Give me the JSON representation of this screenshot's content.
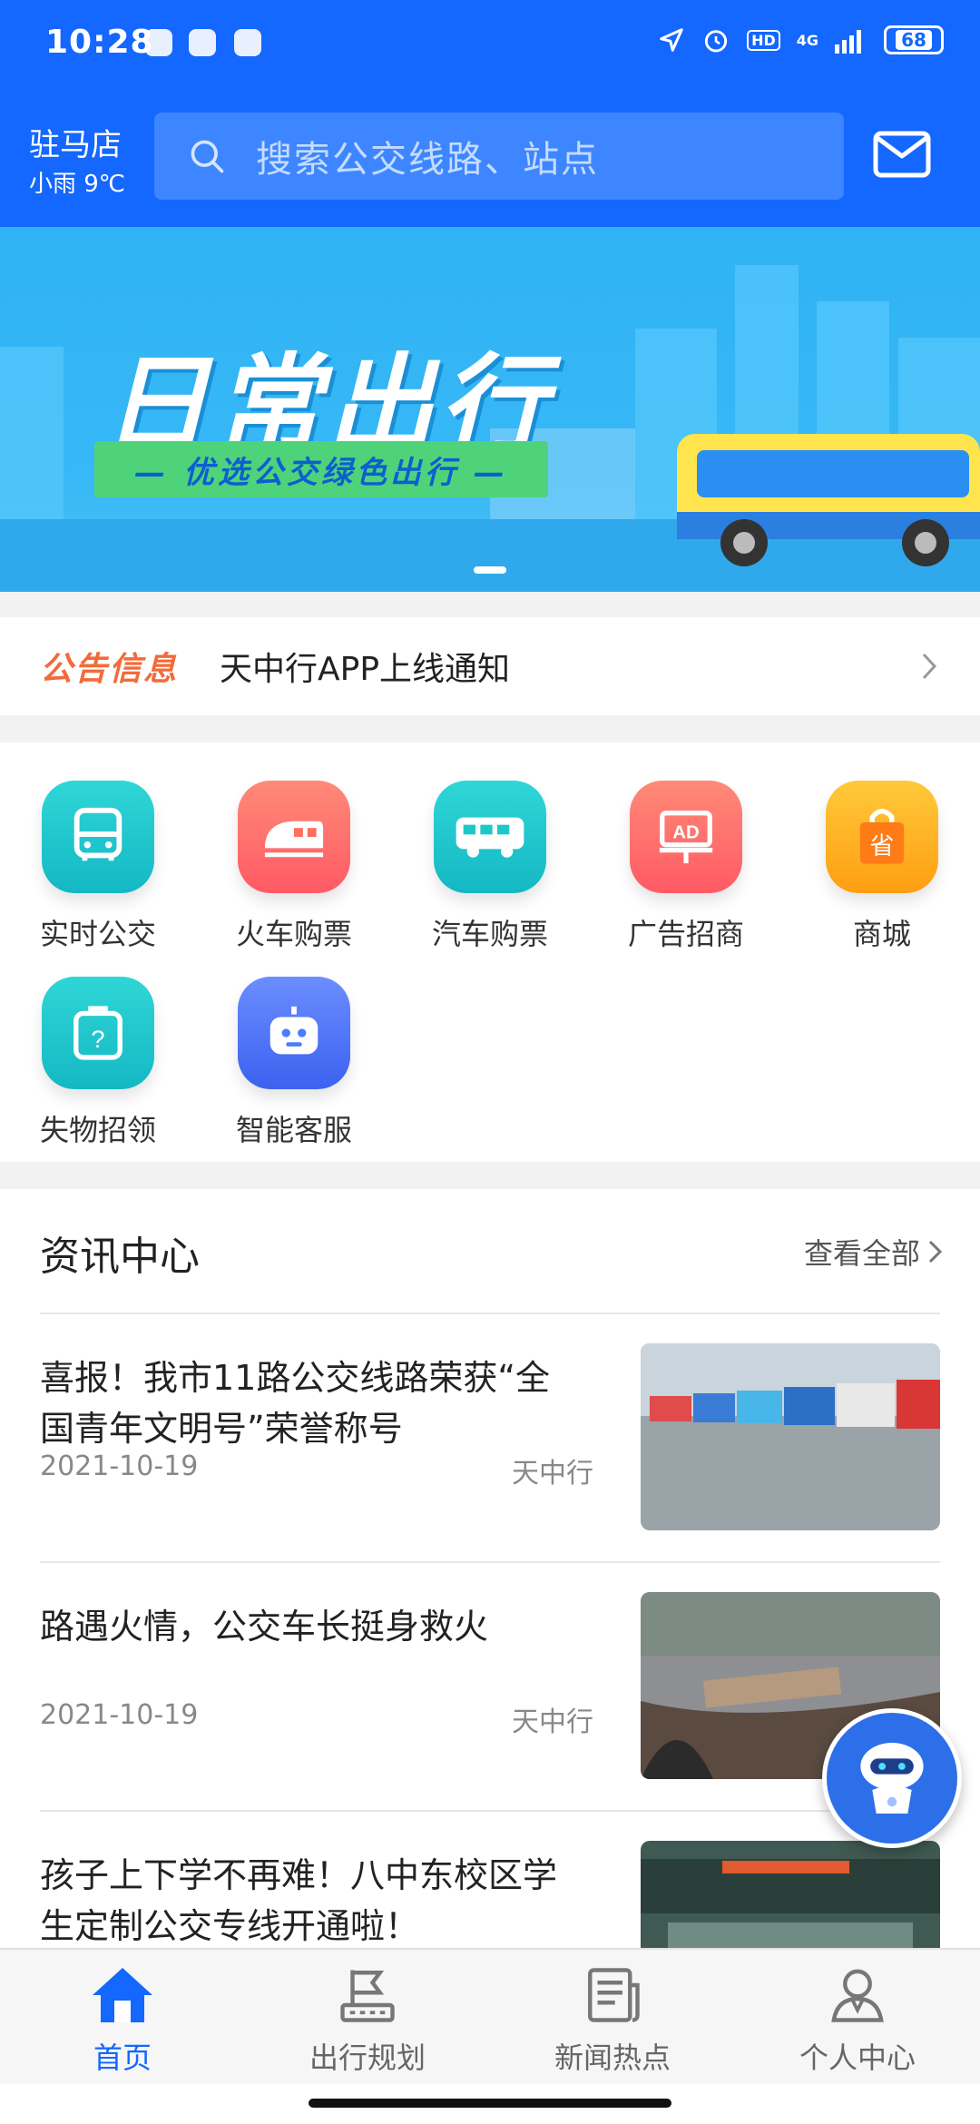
{
  "status_bar": {
    "time": "10:28",
    "network": "4G",
    "hd": "HD",
    "battery": "68"
  },
  "header": {
    "city": "驻马店",
    "weather": "小雨 9℃",
    "search_placeholder": "搜索公交线路、站点"
  },
  "banner": {
    "title": "日常出行",
    "subtitle": "— 优选公交绿色出行 —"
  },
  "notice": {
    "tag": "公告信息",
    "text": "天中行APP上线通知"
  },
  "services": [
    {
      "label": "实时公交",
      "icon": "bus-front-icon",
      "color": "#1ec8c8"
    },
    {
      "label": "火车购票",
      "icon": "train-icon",
      "color": "#ff6f61"
    },
    {
      "label": "汽车购票",
      "icon": "coach-bus-icon",
      "color": "#1ec8c8"
    },
    {
      "label": "广告招商",
      "icon": "ad-board-icon",
      "color": "#ff6f61"
    },
    {
      "label": "商城",
      "icon": "shopping-bag-icon",
      "color": "#ffb21c"
    },
    {
      "label": "失物招领",
      "icon": "luggage-question-icon",
      "color": "#1ec8c8"
    },
    {
      "label": "智能客服",
      "icon": "robot-icon",
      "color": "#4d7bff"
    }
  ],
  "news": {
    "title": "资讯中心",
    "more": "查看全部",
    "articles": [
      {
        "title": "喜报！我市11路公交线路荣获“全国青年文明号”荣誉称号",
        "date": "2021-10-19",
        "source": "天中行"
      },
      {
        "title": "路遇火情，公交车长挺身救火",
        "date": "2021-10-19",
        "source": "天中行"
      },
      {
        "title": "孩子上下学不再难！八中东校区学生定制公交专线开通啦！",
        "date": "",
        "source": ""
      }
    ]
  },
  "tabs": [
    {
      "label": "首页",
      "icon": "home-icon",
      "active": true
    },
    {
      "label": "出行规划",
      "icon": "route-flag-icon",
      "active": false
    },
    {
      "label": "新闻热点",
      "icon": "newspaper-icon",
      "active": false
    },
    {
      "label": "个人中心",
      "icon": "user-icon",
      "active": false
    }
  ],
  "colors": {
    "primary": "#1467ff",
    "notice_tag": "#f26b3a"
  }
}
